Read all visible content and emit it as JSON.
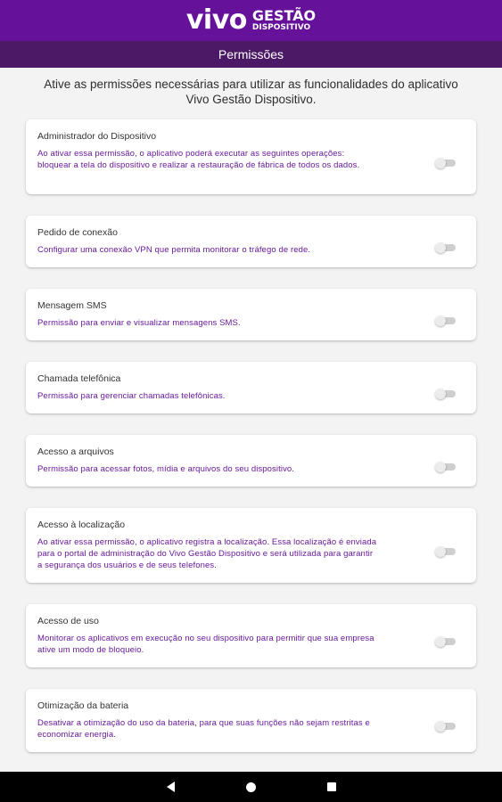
{
  "header": {
    "logo_main": "vivo",
    "logo_line1": "GESTÃO",
    "logo_line2": "DISPOSITIVO"
  },
  "subheader": {
    "title": "Permissões"
  },
  "intro": "Ative as permissões necessárias para utilizar as funcionalidades do aplicativo Vivo Gestão Dispositivo.",
  "permissions": [
    {
      "title": "Administrador do Dispositivo",
      "description": "Ao ativar essa permissão, o aplicativo poderá executar as seguintes operações: bloquear a tela do dispositivo e realizar a restauração de fábrica de todos os dados.",
      "enabled": false
    },
    {
      "title": "Pedido de conexão",
      "description": "Configurar uma conexão VPN que permita monitorar o tráfego de rede.",
      "enabled": false
    },
    {
      "title": "Mensagem SMS",
      "description": "Permissão para enviar e visualizar mensagens SMS.",
      "enabled": false
    },
    {
      "title": "Chamada telefônica",
      "description": "Permissão para gerenciar chamadas telefônicas.",
      "enabled": false
    },
    {
      "title": "Acesso a arquivos",
      "description": "Permissão para acessar fotos, mídia e arquivos do seu dispositivo.",
      "enabled": false
    },
    {
      "title": "Acesso à localização",
      "description": "Ao ativar essa permissão, o aplicativo registra a localização. Essa localização é enviada para o portal de administração do Vivo Gestão Dispositivo e será utilizada para garantir a segurança dos usuários e de seus telefones.",
      "enabled": false
    },
    {
      "title": "Acesso de uso",
      "description": "Monitorar os aplicativos em execução no seu dispositivo para permitir que sua empresa ative um modo de bloqueio.",
      "enabled": false
    },
    {
      "title": "Otimização da bateria",
      "description": "Desativar a otimização do uso da bateria, para que suas funções não sejam restritas e economizar energia.",
      "enabled": false
    }
  ],
  "navbar": {
    "back_icon": "triangle-back-icon",
    "home_icon": "circle-home-icon",
    "recents_icon": "square-recents-icon"
  },
  "colors": {
    "brand_purple": "#65119a",
    "subheader_purple": "#4c1967",
    "description_purple": "#6a1b9a"
  }
}
